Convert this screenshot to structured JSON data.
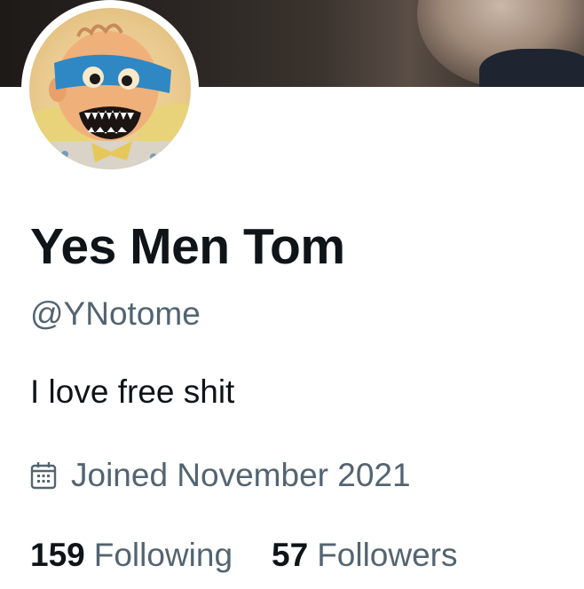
{
  "profile": {
    "display_name": "Yes Men Tom",
    "handle": "@YNotome",
    "bio": "I love free shit",
    "joined": "Joined November 2021",
    "avatar_icon": "masked-baby-avatar",
    "calendar_icon": "calendar-icon"
  },
  "stats": {
    "following_count": "159",
    "following_label": "Following",
    "followers_count": "57",
    "followers_label": "Followers"
  },
  "colors": {
    "primary_text": "#0f1419",
    "secondary_text": "#536471",
    "background": "#ffffff"
  }
}
